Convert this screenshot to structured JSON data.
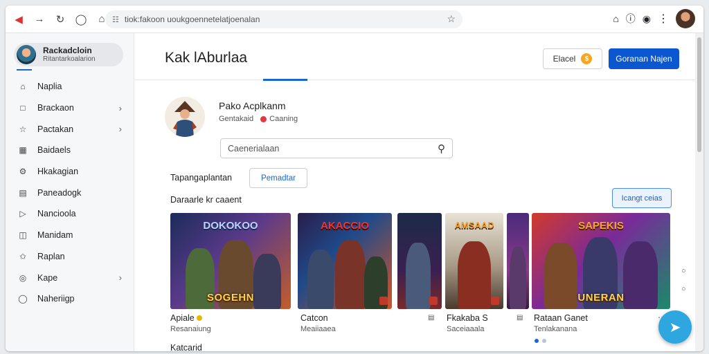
{
  "browser": {
    "url": "tiok:fakoon uoukgoennetelatjoenalan"
  },
  "sidebar": {
    "profile_name": "Rackadcloin",
    "profile_sub": "Ritantarkoalarion",
    "items": [
      {
        "label": "Naplia",
        "icon": "home-icon",
        "chevron": false
      },
      {
        "label": "Brackaon",
        "icon": "square-icon",
        "chevron": true
      },
      {
        "label": "Pactakan",
        "icon": "star-icon",
        "chevron": true
      },
      {
        "label": "Baidaels",
        "icon": "grid-icon",
        "chevron": false
      },
      {
        "label": "Hkakagian",
        "icon": "gear-icon",
        "chevron": false
      },
      {
        "label": "Paneadogk",
        "icon": "document-icon",
        "chevron": false
      },
      {
        "label": "Nancioola",
        "icon": "play-icon",
        "chevron": false
      },
      {
        "label": "Manidam",
        "icon": "book-icon",
        "chevron": false
      },
      {
        "label": "Raplan",
        "icon": "star-outline-icon",
        "chevron": false
      },
      {
        "label": "Kape",
        "icon": "target-icon",
        "chevron": true
      },
      {
        "label": "Naheriigp",
        "icon": "help-icon",
        "chevron": false
      }
    ]
  },
  "header": {
    "title": "Kak lAburlaa",
    "outline_button": "Elacel",
    "primary_button": "Goranan Najen"
  },
  "main": {
    "app_name": "Pako Acplkanm",
    "app_sub_left": "Gentakaid",
    "app_sub_right": "Caaning",
    "search_placeholder": "Caenerialaan",
    "row_label": "Tapangaplantan",
    "row_button": "Pemadtar",
    "section_title": "Daraarle kr caaent",
    "section_button": "Icangt ceias",
    "cards": [
      {
        "top_text": "DOKOKOO",
        "bottom_text": "SOGEHN",
        "caption": "Apiale",
        "sub": "Resanaiung"
      },
      {
        "top_text": "AKACCIO",
        "bottom_text": "",
        "caption": "Catcon",
        "sub": "Meaiiaaea"
      },
      {
        "top_text": "",
        "bottom_text": "",
        "caption": "",
        "sub": ""
      },
      {
        "top_text": "AMSAAD",
        "bottom_text": "",
        "caption": "Fkakaba S",
        "sub": "Saceiaaala"
      },
      {
        "top_text": "",
        "bottom_text": "",
        "caption": "",
        "sub": ""
      },
      {
        "top_text": "SAPEKIS",
        "bottom_text": "UNERAN",
        "caption": "Rataan Ganet",
        "sub": "Tenlakanana"
      }
    ],
    "bottom_label": "Katcarid"
  },
  "colors": {
    "primary": "#0b57d0",
    "fab": "#2ea7e0"
  }
}
